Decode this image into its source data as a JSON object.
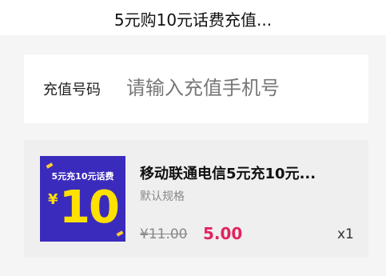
{
  "header": {
    "title": "5元购10元话费充值..."
  },
  "phone": {
    "label": "充值号码",
    "placeholder": "请输入充值手机号",
    "value": ""
  },
  "product": {
    "thumb_caption": "5元充10元话费",
    "thumb_currency": "¥",
    "thumb_amount": "10",
    "title": "移动联通电信5元充10元...",
    "spec": "默认规格",
    "original_price": "¥11.00",
    "sale_price": "5.00",
    "quantity": "x1"
  },
  "colors": {
    "accent_price": "#e0245e",
    "thumb_background": "#3b2bbd",
    "thumb_highlight": "#ffe100"
  }
}
